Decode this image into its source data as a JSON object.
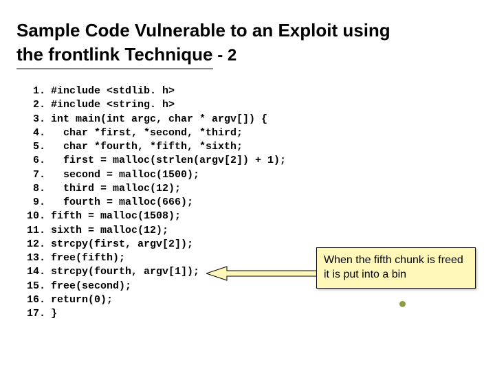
{
  "title": {
    "line1": "Sample Code Vulnerable to an Exploit using",
    "line2_underlined": "the frontlink Technique",
    "suffix": " - 2"
  },
  "code_lines": [
    {
      "n": "1.",
      "t": "#include <stdlib. h>"
    },
    {
      "n": "2.",
      "t": "#include <string. h>"
    },
    {
      "n": "3.",
      "t": "int main(int argc, char * argv[]) {"
    },
    {
      "n": "4.",
      "t": "  char *first, *second, *third;"
    },
    {
      "n": "5.",
      "t": "  char *fourth, *fifth, *sixth;"
    },
    {
      "n": "6.",
      "t": "  first = malloc(strlen(argv[2]) + 1);"
    },
    {
      "n": "7.",
      "t": "  second = malloc(1500);"
    },
    {
      "n": "8.",
      "t": "  third = malloc(12);"
    },
    {
      "n": "9.",
      "t": "  fourth = malloc(666);"
    },
    {
      "n": "10.",
      "t": "fifth = malloc(1508);"
    },
    {
      "n": "11.",
      "t": "sixth = malloc(12);"
    },
    {
      "n": "12.",
      "t": "strcpy(first, argv[2]);"
    },
    {
      "n": "13.",
      "t": "free(fifth);"
    },
    {
      "n": "14.",
      "t": "strcpy(fourth, argv[1]);"
    },
    {
      "n": "15.",
      "t": "free(second);"
    },
    {
      "n": "16.",
      "t": "return(0);"
    },
    {
      "n": "17.",
      "t": "}"
    }
  ],
  "callout_text": "When the fifth chunk is freed it is put into a bin"
}
